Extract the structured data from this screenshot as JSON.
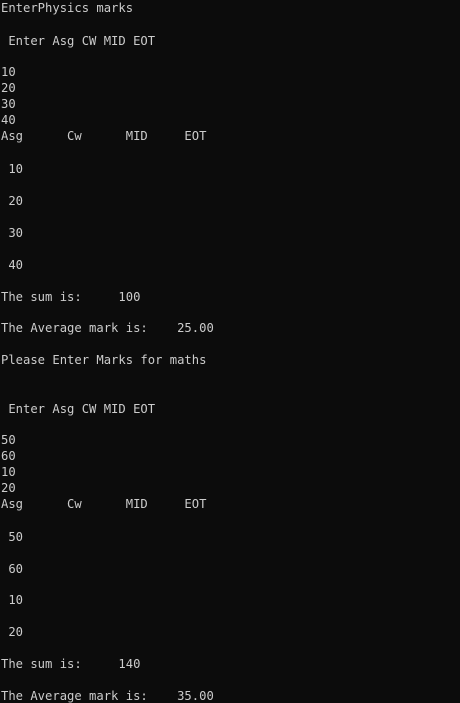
{
  "console": {
    "lines": [
      "EnterPhysics marks",
      " Enter Asg CW MID EOT",
      "10",
      "20",
      "30",
      "40",
      "Asg      Cw      MID     EOT",
      " 10",
      " 20",
      " 30",
      " 40",
      "The sum is:     100",
      "The Average mark is:    25.00",
      "Please Enter Marks for maths",
      " Enter Asg CW MID EOT",
      "50",
      "60",
      "10",
      "20",
      "Asg      Cw      MID     EOT",
      " 50",
      " 60",
      " 10",
      " 20",
      "The sum is:     140",
      "The Average mark is:    35.00"
    ]
  }
}
